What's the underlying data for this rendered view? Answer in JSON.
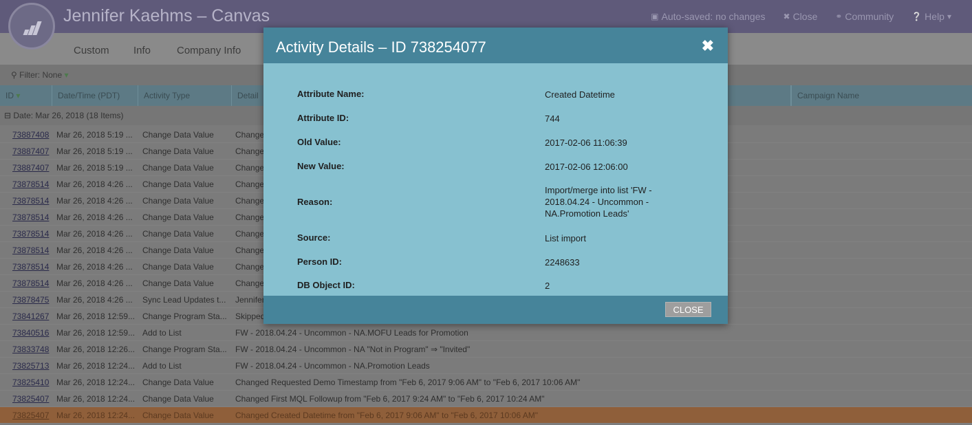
{
  "header": {
    "title": "Jennifer Kaehms – Canvas",
    "actions": [
      {
        "icon": "save-icon",
        "label": "Auto-saved: no changes"
      },
      {
        "icon": "close-x-icon",
        "label": "Close"
      },
      {
        "icon": "community-icon",
        "label": "Community"
      },
      {
        "icon": "help-icon",
        "label": "Help"
      }
    ]
  },
  "tabs": [
    "Custom",
    "Info",
    "Company Info"
  ],
  "filter": {
    "label": "Filter: None"
  },
  "columns": {
    "id": "ID",
    "datetime": "Date/Time (PDT)",
    "activity_type": "Activity Type",
    "detail": "Detail",
    "campaign": "Campaign Name"
  },
  "group": {
    "label": "Date: Mar 26, 2018 (18 Items)"
  },
  "rows": [
    {
      "id": "73887408",
      "dt": "Mar 26, 2018 5:19 ...",
      "type": "Change Data Value",
      "detail": "Change"
    },
    {
      "id": "73887407",
      "dt": "Mar 26, 2018 5:19 ...",
      "type": "Change Data Value",
      "detail": "Change"
    },
    {
      "id": "73887407",
      "dt": "Mar 26, 2018 5:19 ...",
      "type": "Change Data Value",
      "detail": "Change"
    },
    {
      "id": "73878514",
      "dt": "Mar 26, 2018 4:26 ...",
      "type": "Change Data Value",
      "detail": "Change"
    },
    {
      "id": "73878514",
      "dt": "Mar 26, 2018 4:26 ...",
      "type": "Change Data Value",
      "detail": "Change"
    },
    {
      "id": "73878514",
      "dt": "Mar 26, 2018 4:26 ...",
      "type": "Change Data Value",
      "detail": "Change"
    },
    {
      "id": "73878514",
      "dt": "Mar 26, 2018 4:26 ...",
      "type": "Change Data Value",
      "detail": "Change"
    },
    {
      "id": "73878514",
      "dt": "Mar 26, 2018 4:26 ...",
      "type": "Change Data Value",
      "detail": "Change"
    },
    {
      "id": "73878514",
      "dt": "Mar 26, 2018 4:26 ...",
      "type": "Change Data Value",
      "detail": "Change"
    },
    {
      "id": "73878514",
      "dt": "Mar 26, 2018 4:26 ...",
      "type": "Change Data Value",
      "detail": "Change"
    },
    {
      "id": "73878475",
      "dt": "Mar 26, 2018 4:26 ...",
      "type": "Sync Lead Updates t...",
      "detail": "Jennifer"
    },
    {
      "id": "73841267",
      "dt": "Mar 26, 2018 12:59...",
      "type": "Change Program Sta...",
      "detail": "Skipped"
    },
    {
      "id": "73840516",
      "dt": "Mar 26, 2018 12:59...",
      "type": "Add to List",
      "detail": "FW - 2018.04.24 - Uncommon - NA.MOFU Leads for Promotion"
    },
    {
      "id": "73833748",
      "dt": "Mar 26, 2018 12:26...",
      "type": "Change Program Sta...",
      "detail": "FW - 2018.04.24 - Uncommon - NA \"Not in Program\" ⇒ \"Invited\""
    },
    {
      "id": "73825713",
      "dt": "Mar 26, 2018 12:24...",
      "type": "Add to List",
      "detail": "FW - 2018.04.24 - Uncommon - NA.Promotion Leads"
    },
    {
      "id": "73825410",
      "dt": "Mar 26, 2018 12:24...",
      "type": "Change Data Value",
      "detail": "Changed Requested Demo Timestamp from \"Feb 6, 2017 9:06 AM\" to \"Feb 6, 2017 10:06 AM\""
    },
    {
      "id": "73825407",
      "dt": "Mar 26, 2018 12:24...",
      "type": "Change Data Value",
      "detail": "Changed First MQL Followup from \"Feb 6, 2017 9:24 AM\" to \"Feb 6, 2017 10:24 AM\""
    },
    {
      "id": "73825407",
      "dt": "Mar 26, 2018 12:24...",
      "type": "Change Data Value",
      "detail": "Changed Created Datetime from \"Feb 6, 2017 9:06 AM\" to \"Feb 6, 2017 10:06 AM\""
    }
  ],
  "modal": {
    "title": "Activity Details – ID 738254077",
    "close_label": "CLOSE",
    "attributes": [
      {
        "key": "Attribute Name:",
        "value": "Created Datetime"
      },
      {
        "key": "Attribute ID:",
        "value": "744"
      },
      {
        "key": "Old Value:",
        "value": "2017-02-06 11:06:39"
      },
      {
        "key": "New Value:",
        "value": "2017-02-06 12:06:00"
      },
      {
        "key": "Reason:",
        "value": "Import/merge into list 'FW - 2018.04.24 - Uncommon - NA.Promotion Leads'"
      },
      {
        "key": "Source:",
        "value": "List import"
      },
      {
        "key": "Person ID:",
        "value": "2248633"
      },
      {
        "key": "DB Object ID:",
        "value": "2"
      }
    ]
  }
}
